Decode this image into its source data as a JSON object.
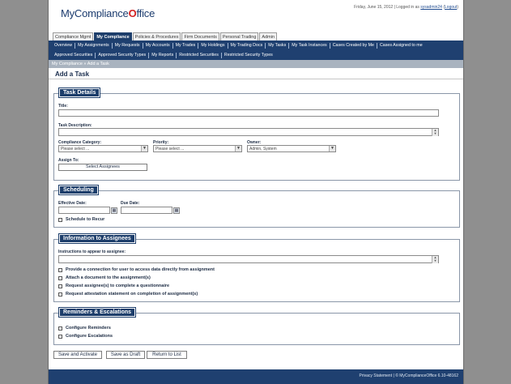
{
  "header": {
    "logo_text": "MyCompliance",
    "logo_check": "O",
    "logo_suffix": "ffice",
    "date": "Friday, June 15, 2012",
    "logged_in_prefix": "| Logged in as",
    "username": "sysadmin24",
    "logout": "Logout"
  },
  "module_tabs": [
    {
      "label": "Compliance Mgmt",
      "active": false
    },
    {
      "label": "My Compliance",
      "active": true
    },
    {
      "label": "Policies & Procedures",
      "active": false
    },
    {
      "label": "Firm Documents",
      "active": false
    },
    {
      "label": "Personal Trading",
      "active": false
    },
    {
      "label": "Admin",
      "active": false
    }
  ],
  "nav": {
    "row1": [
      "Overview",
      "My Assignments",
      "My Requests",
      "My Accounts",
      "My Trades",
      "My Holdings",
      "My Trading Docs",
      "My Tasks",
      "My Task Instances",
      "Cases Created by Me",
      "Cases Assigned to me"
    ],
    "row2": [
      "Approved Securities",
      "Approved Security Types",
      "My Reports",
      "Restricted Securities",
      "Restricted Security Types"
    ]
  },
  "breadcrumb": "My Compliance » Add a Task",
  "page_title": "Add a Task",
  "task_details": {
    "legend": "Task Details",
    "title_label": "Title:",
    "title_value": "",
    "desc_label": "Task Description:",
    "category_label": "Compliance Category:",
    "category_value": "Please select ...",
    "priority_label": "Priority:",
    "priority_value": "Please select ...",
    "owner_label": "Owner:",
    "owner_value": "Admin, System",
    "assign_label": "Assign To:",
    "assign_button": "Select Assignees"
  },
  "scheduling": {
    "legend": "Scheduling",
    "effective_label": "Effective Date:",
    "due_label": "Due Date:",
    "recur_label": "Schedule to Recur"
  },
  "information": {
    "legend": "Information to Assignees",
    "instructions_label": "Instructions to appear to assignee:",
    "options": [
      "Provide a connection for user to access data directly from assignment",
      "Attach a document to the assignment(s)",
      "Request assignee(s) to complete a questionnaire",
      "Request attestation statement on completion of assignment(s)"
    ]
  },
  "reminders": {
    "legend": "Reminders & Escalations",
    "options": [
      "Configure Reminders",
      "Configure Escalations"
    ]
  },
  "actions": {
    "save_activate": "Save and Activate",
    "save_draft": "Save as Draft",
    "return": "Return to List"
  },
  "footer": {
    "privacy": "Privacy Statement",
    "copyright": "| © MyComplianceOffice 6.10-48162"
  }
}
